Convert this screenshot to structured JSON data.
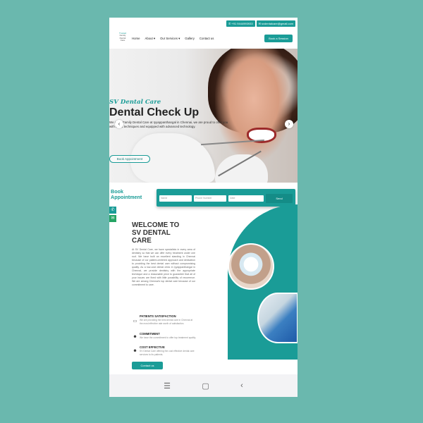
{
  "topbar": {
    "phone": "+91 9444993933",
    "email": "svdentalcare@gmail.com"
  },
  "logo": {
    "line1": "Trusted",
    "line2": "Family",
    "line3": "Dental",
    "line4": "Care"
  },
  "nav": {
    "items": [
      "Home",
      "About ▾",
      "Our Services ▾",
      "Gallery",
      "Contact us"
    ],
    "book_button": "Book a Session"
  },
  "hero": {
    "subtitle": "SV Dental Care",
    "title": "Dental Check Up",
    "description": "We are a Family Dental Care at Iyyappanthangal in Chennai, we are proud to offer you with latest techniques and equipped with advanced technology.",
    "cta": "Book Appointment",
    "prev_arrow": "‹",
    "next_arrow": "›"
  },
  "booking": {
    "label_line1": "Book",
    "label_line2": "Appointment",
    "name_placeholder": "Name",
    "phone_placeholder": "Phone Number",
    "date_placeholder": "Date",
    "send": "Send"
  },
  "floating": {
    "phone_icon": "✆",
    "whatsapp_icon": "✉"
  },
  "welcome": {
    "line1": "WELCOME TO",
    "line2": "SV DENTAL",
    "line3": "CARE",
    "body": "At SV Dental Care, we have specialists in every area of dentistry so that we can offer every treatment under one roof. We have built an excellent standing in Chennai because of our patient-centered approach and dedication to providing the best dental care without compromising quality. As a low-cost dental clinic in Iyyappanthangal in Chennai, we provide dentistry with the appropriate technique and a reasonable price to guarantee that all of your issues are fixed with little possibility of recurrence. We are among Chennai's top dental care because of our commitment to care.",
    "features": [
      {
        "icon": "laptop-icon",
        "glyph": "▭",
        "title": "PATIENTS SATISFACTION",
        "text": "We are providing the best dental care in Chennai at the most effective rate worth of satisfaction."
      },
      {
        "icon": "people-icon",
        "glyph": "☻",
        "title": "COMMITMENT",
        "text": "We have the commitment to offer top treatment quality."
      },
      {
        "icon": "group-icon",
        "glyph": "☻",
        "title": "COST EFFECTIVE",
        "text": "SV Dental Care offering the cost effective dental care services to its patients."
      }
    ],
    "contact_button": "Contact us"
  },
  "system_nav": {
    "menu": "☰",
    "home": "▢",
    "back": "‹"
  },
  "colors": {
    "accent": "#1a9c97",
    "background": "#6ab8ae"
  }
}
